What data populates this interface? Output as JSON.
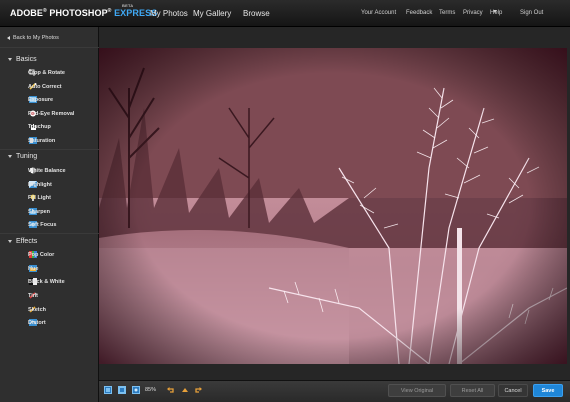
{
  "brand": {
    "adobe": "ADOBE",
    "reg1": "®",
    "photoshop": "PHOTOSHOP",
    "reg2": "®",
    "express": "EXPRESS",
    "beta": "BETA"
  },
  "main_nav": [
    "My Photos",
    "My Gallery",
    "Browse"
  ],
  "right_nav": {
    "account": "Your Account",
    "feedback": "Feedback",
    "terms": "Terms",
    "privacy": "Privacy",
    "help": "Help",
    "signout": "Sign Out"
  },
  "sidebar": {
    "back_label": "Back to My Photos",
    "sections": [
      {
        "title": "Basics",
        "items": [
          {
            "label": "Crop & Rotate",
            "icon": "crop-icon"
          },
          {
            "label": "Auto Correct",
            "icon": "wand-icon"
          },
          {
            "label": "Exposure",
            "icon": "exposure-icon"
          },
          {
            "label": "Red-Eye Removal",
            "icon": "eye-icon"
          },
          {
            "label": "Touchup",
            "icon": "hand-icon"
          },
          {
            "label": "Saturation",
            "icon": "saturation-icon"
          }
        ]
      },
      {
        "title": "Tuning",
        "items": [
          {
            "label": "White Balance",
            "icon": "balance-icon"
          },
          {
            "label": "Highlight",
            "icon": "highlight-icon"
          },
          {
            "label": "Fill Light",
            "icon": "bulb-icon"
          },
          {
            "label": "Sharpen",
            "icon": "sharpen-icon"
          },
          {
            "label": "Soft Focus",
            "icon": "soft-focus-icon"
          }
        ]
      },
      {
        "title": "Effects",
        "items": [
          {
            "label": "Pop Color",
            "icon": "pop-color-icon"
          },
          {
            "label": "Hue",
            "icon": "hue-icon"
          },
          {
            "label": "Black & White",
            "icon": "bw-icon"
          },
          {
            "label": "Tint",
            "icon": "tint-icon"
          },
          {
            "label": "Sketch",
            "icon": "sketch-icon"
          },
          {
            "label": "Distort",
            "icon": "distort-icon"
          }
        ]
      }
    ]
  },
  "toolbar": {
    "zoom": "85%",
    "view_original": "View Original",
    "reset_all": "Reset All",
    "cancel": "Cancel",
    "save": "Save"
  },
  "colors": {
    "accent": "#1f86d8",
    "express_blue": "#3fa9f5"
  }
}
